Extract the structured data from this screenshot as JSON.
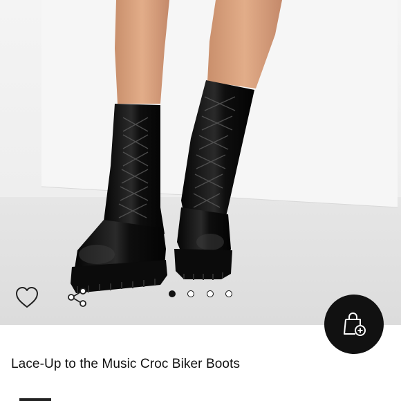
{
  "product": {
    "title": "Lace-Up to the Music Croc Biker Boots"
  },
  "carousel": {
    "total_slides": 4,
    "active_slide": 1
  },
  "actions": {
    "favorite_icon": "heart-outline-icon",
    "share_icon": "share-icon",
    "add_to_bag_icon": "shopping-bag-plus-icon"
  },
  "colors": {
    "accent": "#111111",
    "background": "#ffffff"
  }
}
